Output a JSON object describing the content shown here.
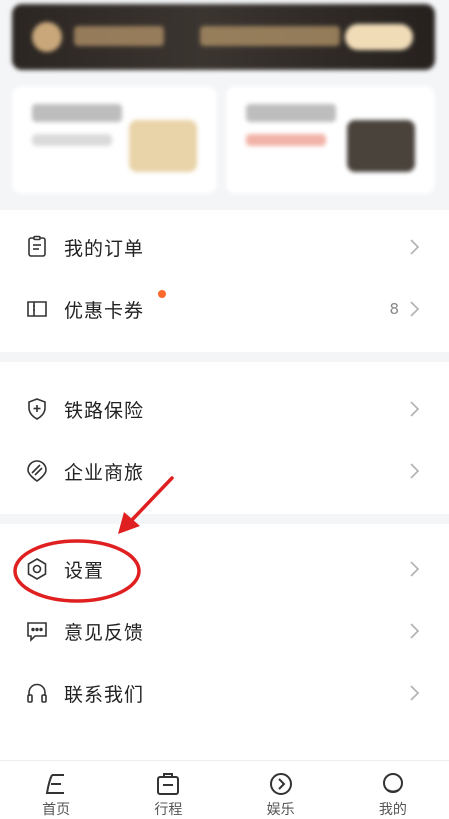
{
  "menu_group_1": [
    {
      "label": "我的订单",
      "icon": "order-list-icon"
    },
    {
      "label": "优惠卡券",
      "icon": "coupon-icon",
      "count": "8",
      "has_dot": true
    }
  ],
  "menu_group_2": [
    {
      "label": "铁路保险",
      "icon": "shield-plus-icon"
    },
    {
      "label": "企业商旅",
      "icon": "location-badge-icon"
    }
  ],
  "menu_group_3": [
    {
      "label": "设置",
      "icon": "settings-hexagon-icon"
    },
    {
      "label": "意见反馈",
      "icon": "feedback-bubble-icon"
    },
    {
      "label": "联系我们",
      "icon": "headphones-icon"
    }
  ],
  "tabs": [
    {
      "label": "首页",
      "icon": "home-icon"
    },
    {
      "label": "行程",
      "icon": "itinerary-icon"
    },
    {
      "label": "娱乐",
      "icon": "entertainment-icon"
    },
    {
      "label": "我的",
      "icon": "profile-icon"
    }
  ],
  "colors": {
    "notification_dot": "#ff6a2c",
    "annotation_red": "#e02020"
  }
}
